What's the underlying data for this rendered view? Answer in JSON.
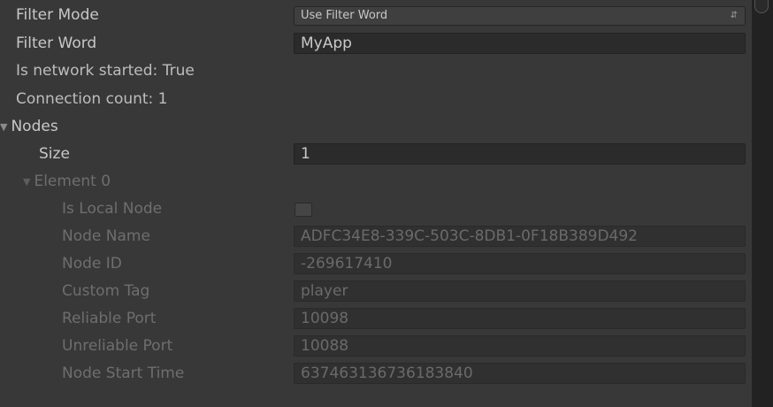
{
  "filter_mode": {
    "label": "Filter Mode",
    "value": "Use Filter Word"
  },
  "filter_word": {
    "label": "Filter Word",
    "value": "MyApp"
  },
  "network_status": "Is network started: True",
  "connection_count": "Connection count: 1",
  "nodes": {
    "label": "Nodes",
    "size_label": "Size",
    "size_value": "1",
    "element_label": "Element 0",
    "element": {
      "is_local_node_label": "Is Local Node",
      "is_local_node_checked": false,
      "node_name_label": "Node Name",
      "node_name_value": "ADFC34E8-339C-503C-8DB1-0F18B389D492",
      "node_id_label": "Node ID",
      "node_id_value": "-269617410",
      "custom_tag_label": "Custom Tag",
      "custom_tag_value": "player",
      "reliable_port_label": "Reliable Port",
      "reliable_port_value": "10098",
      "unreliable_port_label": "Unreliable Port",
      "unreliable_port_value": "10088",
      "node_start_time_label": "Node Start Time",
      "node_start_time_value": "637463136736183840"
    }
  },
  "icons": {
    "expand_nodes": "triangle-down-icon",
    "expand_element": "triangle-down-icon",
    "dropdown": "updown-arrows-icon"
  }
}
